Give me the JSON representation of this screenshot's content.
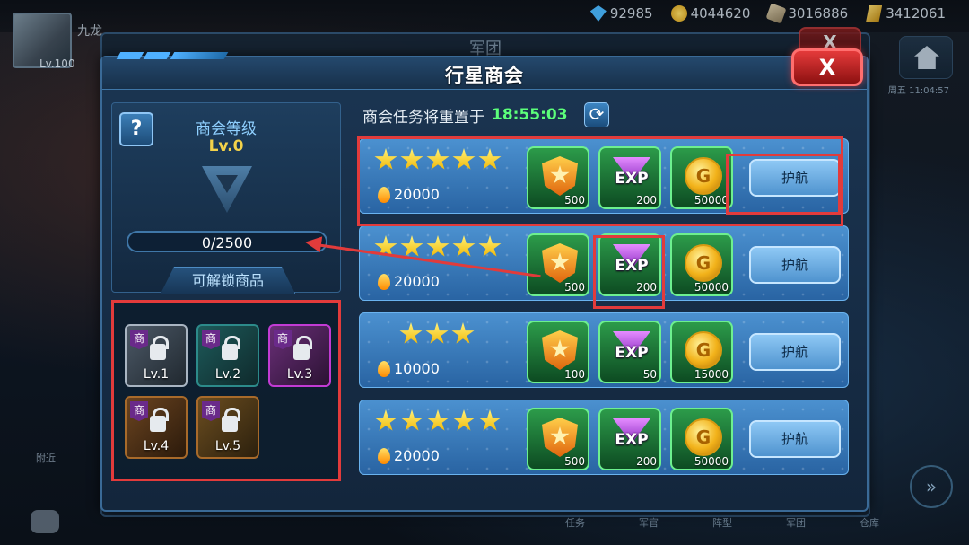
{
  "player": {
    "name": "九龙",
    "level": "Lv.100"
  },
  "resources": [
    {
      "icon": "gem-icon",
      "value": "92985"
    },
    {
      "icon": "gold-coin-icon",
      "value": "4044620"
    },
    {
      "icon": "ore-icon",
      "value": "3016886"
    },
    {
      "icon": "gold-bar-icon",
      "value": "3412061"
    }
  ],
  "background": {
    "window_title": "军团",
    "time": "周五 11:04:57",
    "close_label": "X",
    "nearby_label": "附近"
  },
  "bottom_nav": [
    "任务",
    "军官",
    "阵型",
    "军团",
    "仓库"
  ],
  "dialog": {
    "title": "行星商会",
    "close_label": "X"
  },
  "guild": {
    "help_label": "?",
    "level_title": "商会等级",
    "level_value": "Lv.0",
    "progress_text": "0/2500",
    "progress_fraction": 0,
    "unlock_title": "可解锁商品"
  },
  "unlock_items": [
    {
      "tag": "商",
      "label": "Lv.1",
      "rarity": "white"
    },
    {
      "tag": "商",
      "label": "Lv.2",
      "rarity": "green"
    },
    {
      "tag": "商",
      "label": "Lv.3",
      "rarity": "purple"
    },
    {
      "tag": "商",
      "label": "Lv.4",
      "rarity": "orange"
    },
    {
      "tag": "商",
      "label": "Lv.5",
      "rarity": "orange"
    }
  ],
  "reset": {
    "label": "商会任务将重置于",
    "time": "18:55:03"
  },
  "tasks": [
    {
      "stars": 5,
      "cost": "20000",
      "rewards": {
        "badge": "500",
        "exp": "200",
        "gold": "50000"
      },
      "button": "护航"
    },
    {
      "stars": 5,
      "cost": "20000",
      "rewards": {
        "badge": "500",
        "exp": "200",
        "gold": "50000"
      },
      "button": "护航"
    },
    {
      "stars": 3,
      "cost": "10000",
      "rewards": {
        "badge": "100",
        "exp": "50",
        "gold": "15000"
      },
      "button": "护航"
    },
    {
      "stars": 5,
      "cost": "20000",
      "rewards": {
        "badge": "500",
        "exp": "200",
        "gold": "50000"
      },
      "button": "护航"
    }
  ],
  "exp_label": "EXP",
  "gold_label": "G",
  "colors": {
    "highlight": "#e23b3b",
    "reset_time": "#5cff7a",
    "level_value": "#f3d24a",
    "reward_bg": "#2c9b4a"
  }
}
